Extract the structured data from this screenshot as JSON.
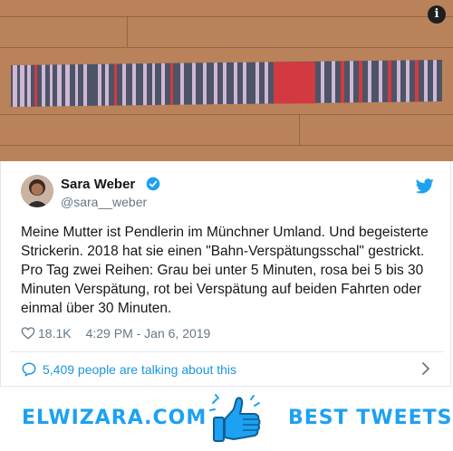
{
  "photo": {
    "info_icon": "info-icon",
    "info_glyph": "i",
    "floor_color": "#b9825a",
    "scarf_colors": {
      "gray": "#4c5466",
      "pink": "#cfb7d6",
      "red": "#d23a41"
    }
  },
  "tweet": {
    "author_name": "Sara Weber",
    "author_handle": "@sara__weber",
    "verified_icon": "verified-badge-icon",
    "bird_icon": "twitter-bird-icon",
    "text": "Meine Mutter ist Pendlerin im Münchner Umland. Und begeisterte Strickerin. 2018 hat sie einen \"Bahn-Verspätungsschal\" gestrickt. Pro Tag zwei Reihen: Grau bei unter 5 Minuten, rosa bei 5 bis 30 Minuten Verspätung, rot bei Verspätung auf beiden Fahrten oder einmal über 30 Minuten.",
    "likes": "18.1K",
    "timestamp": "4:29 PM - Jan 6, 2019",
    "conversation": "5,409 people are talking about this",
    "accent_color": "#1da1f2"
  },
  "footer": {
    "left_brand": "ELWIZARA.COM",
    "right_brand": "BEST TWEETS",
    "thumb_icon": "thumbs-up-icon",
    "brand_color": "#1da1f2"
  }
}
